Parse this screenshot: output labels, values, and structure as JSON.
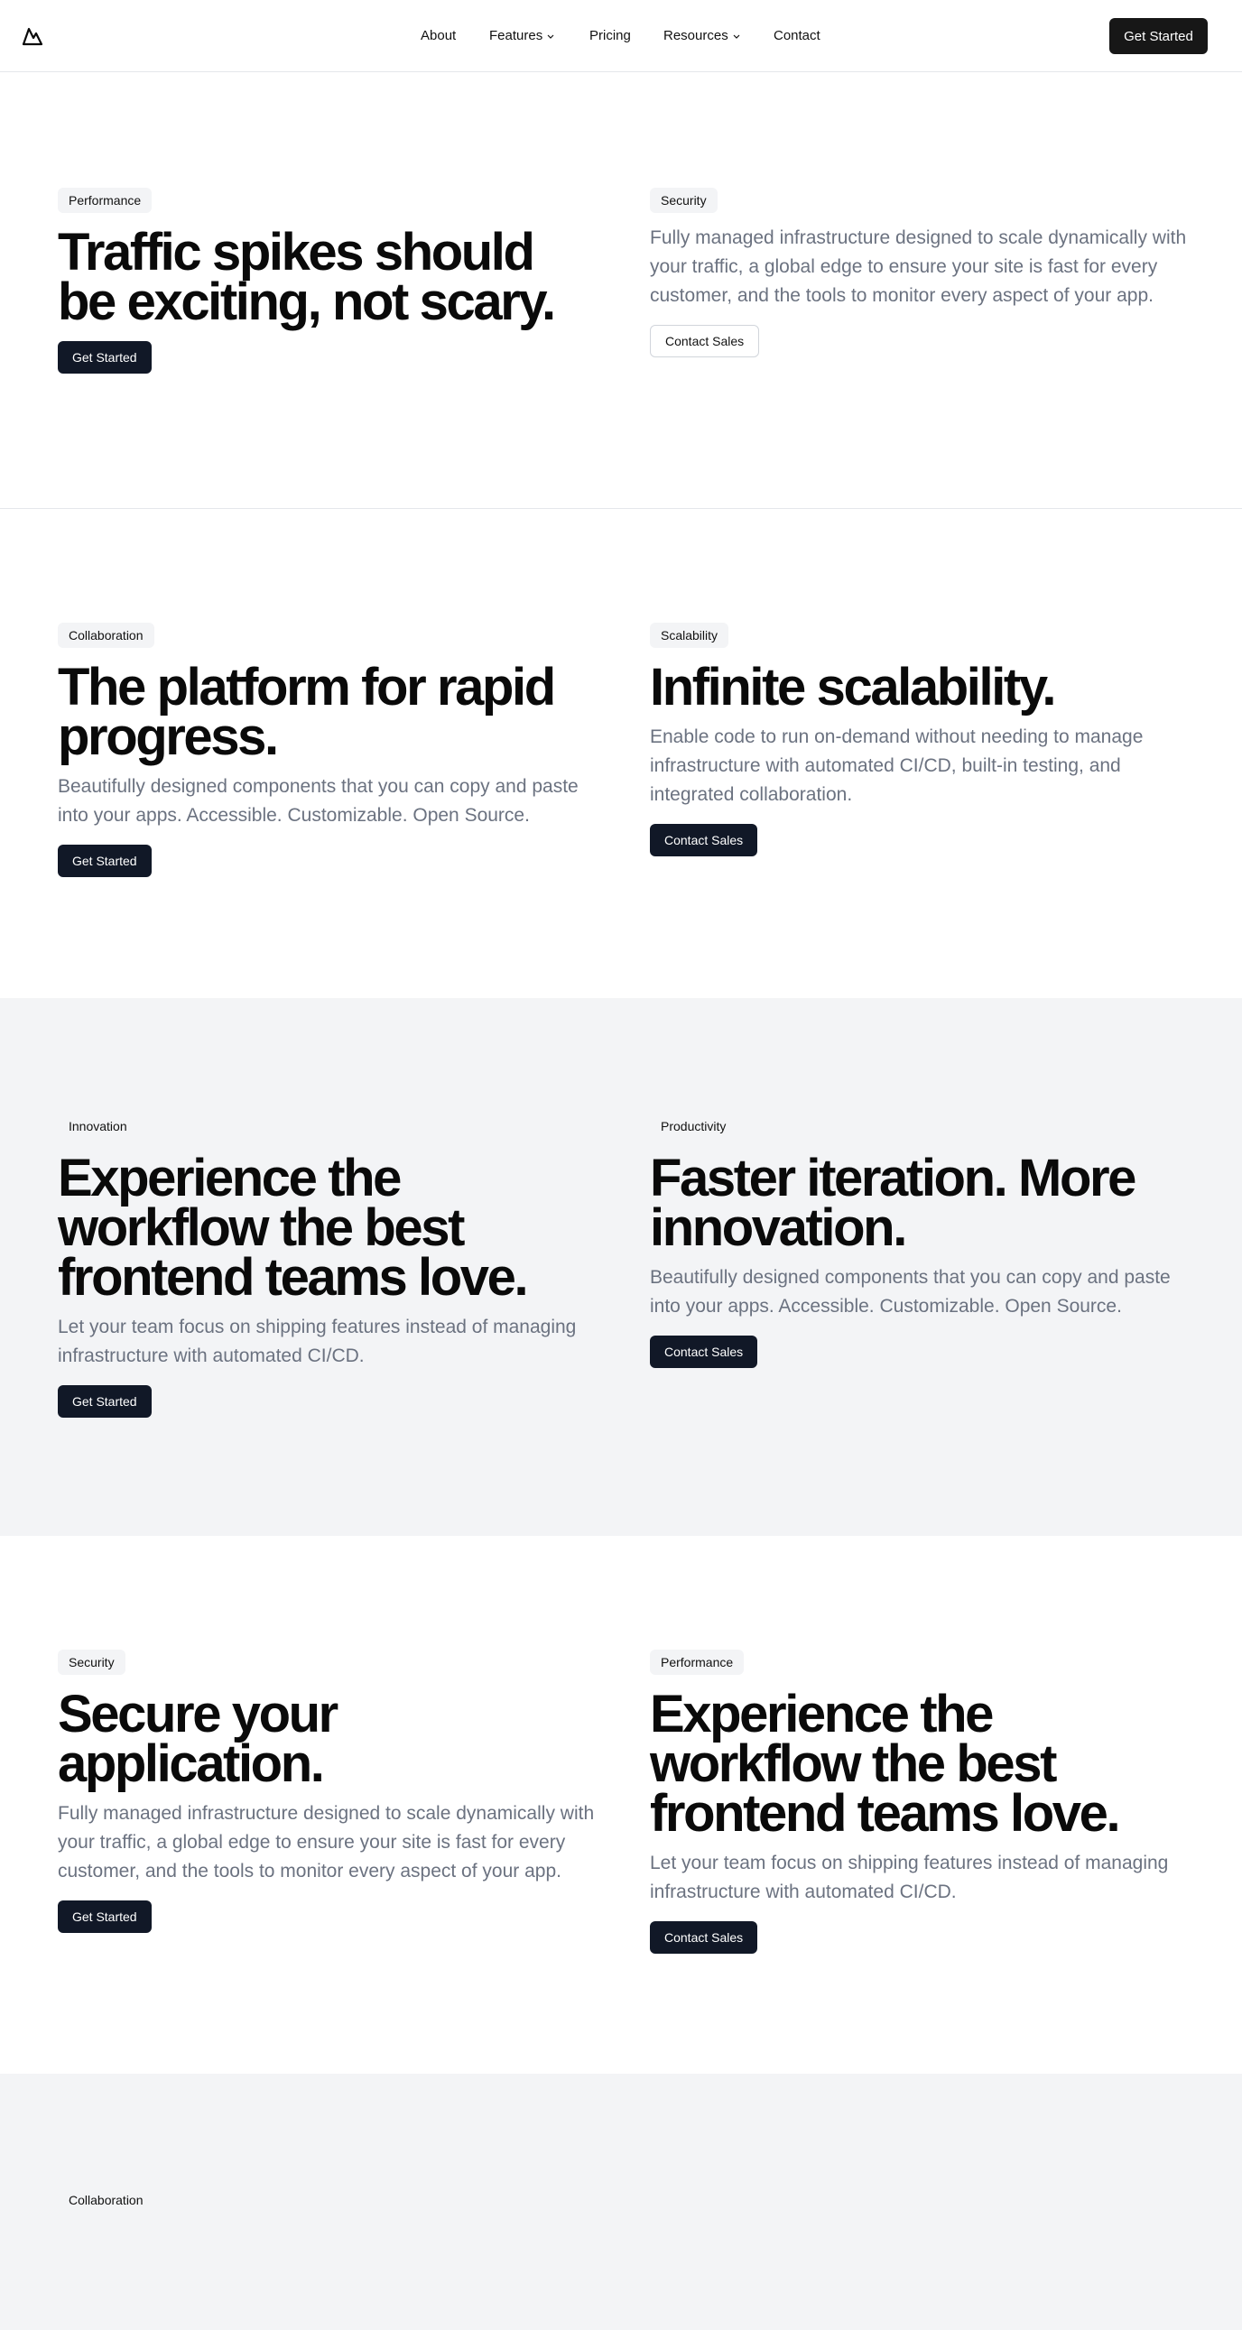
{
  "header": {
    "nav": [
      {
        "label": "About"
      },
      {
        "label": "Features"
      },
      {
        "label": "Pricing"
      },
      {
        "label": "Resources"
      },
      {
        "label": "Contact"
      }
    ],
    "cta": "Get Started"
  },
  "sections": [
    {
      "left": {
        "badge": "Performance",
        "title": "Traffic spikes should be exciting, not scary.",
        "button": "Get Started"
      },
      "right": {
        "badge": "Security",
        "body": "Fully managed infrastructure designed to scale dynamically with your traffic, a global edge to ensure your site is fast for every customer, and the tools to monitor every aspect of your app.",
        "button": "Contact Sales"
      }
    },
    {
      "left": {
        "badge": "Collaboration",
        "title": "The platform for rapid progress.",
        "body": "Beautifully designed components that you can copy and paste into your apps. Accessible. Customizable. Open Source.",
        "button": "Get Started"
      },
      "right": {
        "badge": "Scalability",
        "title": "Infinite scalability.",
        "body": "Enable code to run on-demand without needing to manage infrastructure with automated CI/CD, built-in testing, and integrated collaboration.",
        "button": "Contact Sales"
      }
    },
    {
      "left": {
        "badge": "Innovation",
        "title": "Experience the workflow the best frontend teams love.",
        "body": "Let your team focus on shipping features instead of managing infrastructure with automated CI/CD.",
        "button": "Get Started"
      },
      "right": {
        "badge": "Productivity",
        "title": "Faster iteration. More innovation.",
        "body": "Beautifully designed components that you can copy and paste into your apps. Accessible. Customizable. Open Source.",
        "button": "Contact Sales"
      }
    },
    {
      "left": {
        "badge": "Security",
        "title": "Secure your application.",
        "body": "Fully managed infrastructure designed to scale dynamically with your traffic, a global edge to ensure your site is fast for every customer, and the tools to monitor every aspect of your app.",
        "button": "Get Started"
      },
      "right": {
        "badge": "Performance",
        "title": "Experience the workflow the best frontend teams love.",
        "body": "Let your team focus on shipping features instead of managing infrastructure with automated CI/CD.",
        "button": "Contact Sales"
      }
    },
    {
      "left": {
        "badge": "Collaboration"
      }
    }
  ],
  "colors": {
    "dark_button": "#111827",
    "header_button": "#171717",
    "muted_text": "#6b7280",
    "gray_bg": "#f3f4f6"
  }
}
